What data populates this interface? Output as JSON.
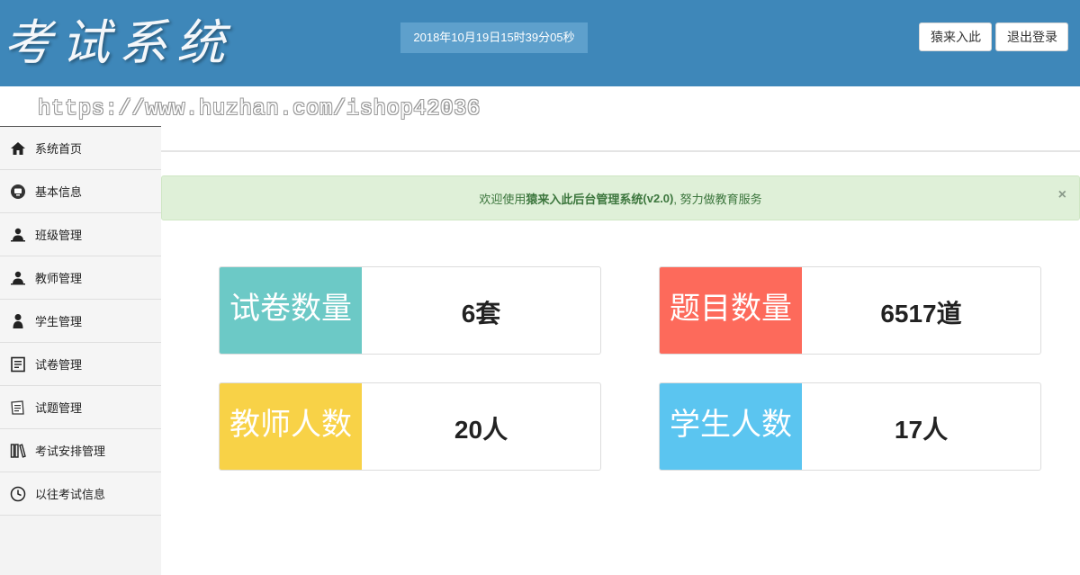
{
  "header": {
    "logo": "考试系统",
    "datetime": "2018年10月19日15时39分05秒",
    "user_button": "猿来入此",
    "logout_button": "退出登录"
  },
  "watermark": "https://www.huzhan.com/ishop42036",
  "sidebar": {
    "items": [
      {
        "label": "系统首页",
        "icon": "home-icon"
      },
      {
        "label": "基本信息",
        "icon": "monitor-icon"
      },
      {
        "label": "班级管理",
        "icon": "users-icon"
      },
      {
        "label": "教师管理",
        "icon": "teacher-icon"
      },
      {
        "label": "学生管理",
        "icon": "student-icon"
      },
      {
        "label": "试卷管理",
        "icon": "document-icon"
      },
      {
        "label": "试题管理",
        "icon": "notepad-icon"
      },
      {
        "label": "考试安排管理",
        "icon": "books-icon"
      },
      {
        "label": "以往考试信息",
        "icon": "clock-icon"
      }
    ]
  },
  "alert": {
    "prefix": "欢迎使用 ",
    "brand": "猿来入此后台管理系统",
    "version": " (v2.0)",
    "suffix": " , 努力做教育服务",
    "close": "×"
  },
  "stats": [
    {
      "label": "试卷数量",
      "value": "6套",
      "color": "#6cc9c6"
    },
    {
      "label": "题目数量",
      "value": "6517道",
      "color": "#fd6a5b"
    },
    {
      "label": "教师人数",
      "value": "20人",
      "color": "#f8d247"
    },
    {
      "label": "学生人数",
      "value": "17人",
      "color": "#5bc5f0"
    }
  ]
}
